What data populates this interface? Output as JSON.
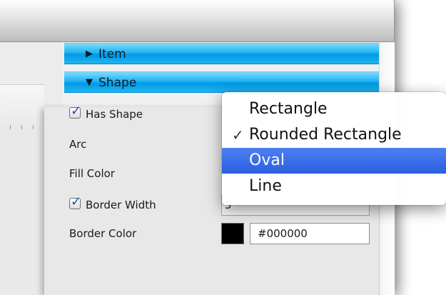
{
  "inspector": {
    "sections": [
      {
        "label": "Item",
        "expanded": false
      },
      {
        "label": "Shape",
        "expanded": true
      }
    ],
    "collapsed_glyph": "▶",
    "expanded_glyph": "▼"
  },
  "shape_panel": {
    "has_shape": {
      "label": "Has Shape",
      "checked": true
    },
    "arc": {
      "label": "Arc"
    },
    "fill_color": {
      "label": "Fill Color"
    },
    "border_width": {
      "label": "Border Width",
      "checked": true,
      "value": "5"
    },
    "border_color": {
      "label": "Border Color",
      "swatch": "#000000",
      "hex": "#000000"
    }
  },
  "shape_menu": {
    "items": [
      {
        "label": "Rectangle",
        "checked": false,
        "selected": false
      },
      {
        "label": "Rounded Rectangle",
        "checked": true,
        "selected": false
      },
      {
        "label": "Oval",
        "checked": false,
        "selected": true
      },
      {
        "label": "Line",
        "checked": false,
        "selected": false
      }
    ],
    "check_glyph": "✓"
  },
  "colors": {
    "section_bar": "#1fb4f2",
    "menu_highlight": "#2a5fe0",
    "checkbox_mark": "#1a4fb8"
  }
}
